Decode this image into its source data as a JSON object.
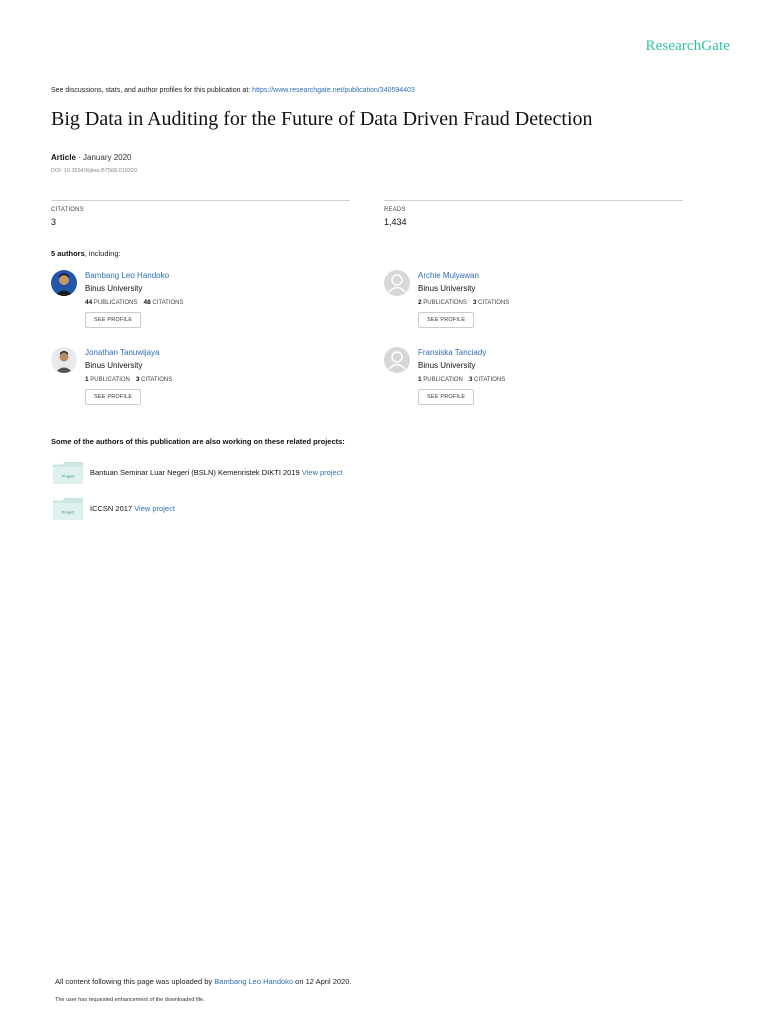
{
  "brand": {
    "name": "ResearchGate"
  },
  "header": {
    "see_discussions_text": "See discussions, stats, and author profiles for this publication at: ",
    "publication_url": "https://www.researchgate.net/publication/340594403"
  },
  "publication": {
    "title": "Big Data in Auditing for the Future of Data Driven Fraud Detection",
    "type": "Article",
    "date": " · January 2020",
    "doi": "DOI: 10.35940/ijitee.B7568.019320"
  },
  "stats": {
    "citations_label": "CITATIONS",
    "citations_value": "3",
    "reads_label": "READS",
    "reads_value": "1,434"
  },
  "authors_heading": {
    "count": "5 authors",
    "suffix": ", including:"
  },
  "authors": [
    {
      "name": "Bambang Leo Handoko",
      "institution": "Binus University",
      "publications": "44",
      "publications_label": "PUBLICATIONS",
      "citations": "48",
      "citations_label": "CITATIONS",
      "button": "SEE PROFILE"
    },
    {
      "name": "Archie Mulyawan",
      "institution": "Binus University",
      "publications": "2",
      "publications_label": "PUBLICATIONS",
      "citations": "3",
      "citations_label": "CITATIONS",
      "button": "SEE PROFILE"
    },
    {
      "name": "Jonathan Tanuwijaya",
      "institution": "Binus University",
      "publications": "1",
      "publications_label": "PUBLICATION",
      "citations": "3",
      "citations_label": "CITATIONS",
      "button": "SEE PROFILE"
    },
    {
      "name": "Fransiska Tanciady",
      "institution": "Binus University",
      "publications": "1",
      "publications_label": "PUBLICATION",
      "citations": "3",
      "citations_label": "CITATIONS",
      "button": "SEE PROFILE"
    }
  ],
  "related": {
    "heading": "Some of the authors of this publication are also working on these related projects:",
    "icon_label": "Project",
    "projects": [
      {
        "name": "Bantuan Seminar Luar Negeri (BSLN) Kemenristek DIKTI 2019 ",
        "link": "View project"
      },
      {
        "name": "ICCSN 2017 ",
        "link": "View project"
      }
    ]
  },
  "footer": {
    "upload_prefix": "All content following this page was uploaded by ",
    "uploader": "Bambang Leo Handoko",
    "upload_suffix": " on 12 April 2020.",
    "note": "The user has requested enhancement of the downloaded file."
  },
  "colors": {
    "brand": "#2fc3a6",
    "link": "#2f6fb3",
    "folder": "#cfe8e4"
  },
  "icons": [
    "folder-icon",
    "avatar-photo",
    "avatar-placeholder-icon"
  ]
}
